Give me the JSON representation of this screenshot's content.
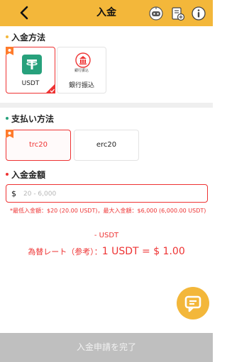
{
  "header": {
    "title": "入金",
    "background": "#f3b73a",
    "icons": [
      "back-arrow-icon",
      "support-robot-icon",
      "deposit-record-icon",
      "help-icon"
    ]
  },
  "deposit_method": {
    "title": "入金方法",
    "items": [
      {
        "label": "USDT",
        "icon": "usdt-tether-icon",
        "selected": true
      },
      {
        "label": "銀行振込",
        "mini_label": "銀行振込",
        "icon": "bank-transfer-icon",
        "selected": false
      }
    ]
  },
  "payment_method": {
    "title": "支払い方法",
    "items": [
      {
        "label": "trc20",
        "selected": true
      },
      {
        "label": "erc20",
        "selected": false
      }
    ]
  },
  "amount": {
    "title": "入金金額",
    "currency_symbol": "$",
    "value": "",
    "placeholder": "20 - 6,000",
    "limit_note": "*最低入金額：$20 (20.00 USDT)，最大入金額：$6,000 (6,000.00 USDT)"
  },
  "conversion": {
    "usdt_amount": "- USDT",
    "rate_label": "為替レート（参考）：",
    "rate_value": "1 USDT = $ 1.00"
  },
  "chat_fab": {
    "icon": "chat-bubble-icon"
  },
  "submit": {
    "label": "入金申請を完了"
  },
  "colors": {
    "accent": "#f3b73a",
    "error": "#ee3333",
    "section_dot_1": "#f3b73a",
    "section_dot_2": "#27a17c",
    "section_dot_3": "#e33333",
    "usdt_green": "#27a17c",
    "disabled": "#bfbfbf"
  }
}
